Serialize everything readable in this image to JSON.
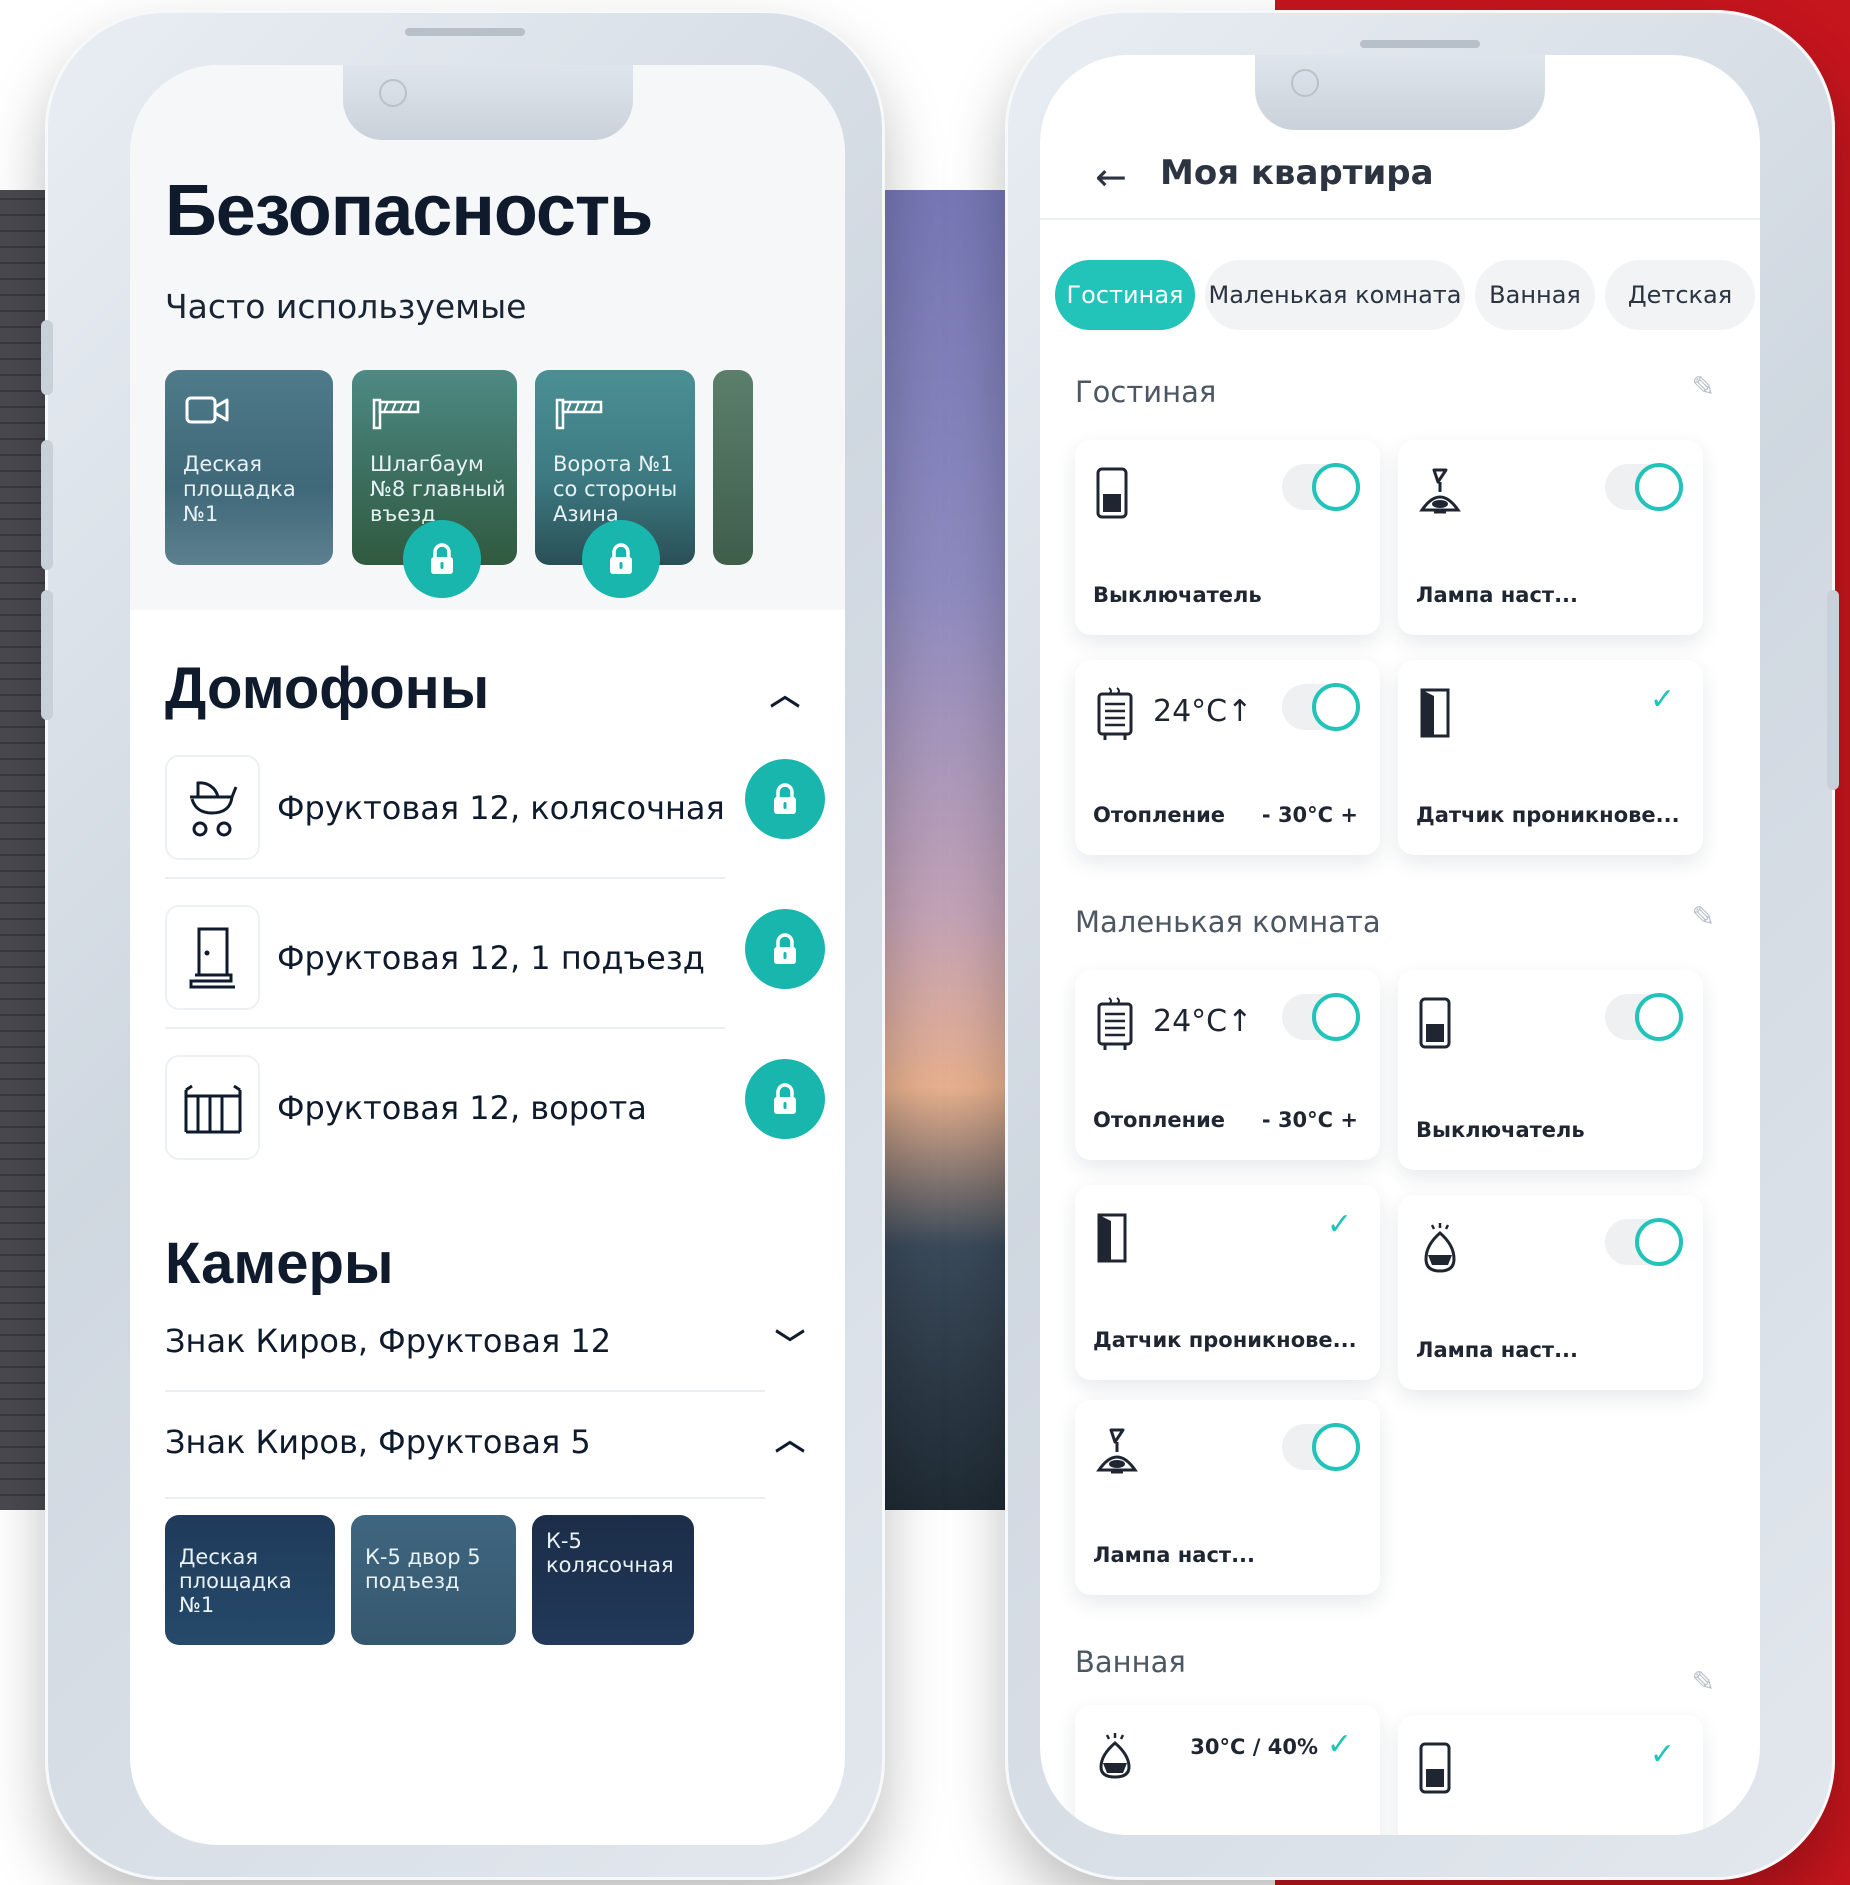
{
  "left_phone": {
    "title": "Безопасность",
    "favorites_heading": "Часто используемые",
    "favorites": [
      {
        "label": "Деская площадка №1",
        "icon": "video-camera-icon"
      },
      {
        "label": "Шлагбаум №8 главный въезд",
        "icon": "barrier-icon"
      },
      {
        "label": "Ворота №1 со стороны Азина",
        "icon": "barrier-icon"
      }
    ],
    "intercoms": {
      "heading": "Домофоны",
      "items": [
        {
          "label": "Фруктовая 12, колясочная",
          "icon": "stroller-icon"
        },
        {
          "label": "Фруктовая 12, 1 подъезд",
          "icon": "door-icon"
        },
        {
          "label": "Фруктовая 12, ворота",
          "icon": "gate-icon"
        }
      ]
    },
    "cameras": {
      "heading": "Камеры",
      "groups": [
        {
          "label": "Знак Киров, Фруктовая 12",
          "expanded": false
        },
        {
          "label": "Знак Киров, Фруктовая 5",
          "expanded": true
        }
      ],
      "thumbs": [
        "Деская площадка №1",
        "К-5 двор 5 подъезд",
        "К-5 колясочная"
      ]
    }
  },
  "right_phone": {
    "title": "Моя квартира",
    "tabs": [
      "Гостиная",
      "Маленькая комната",
      "Ванная",
      "Детская"
    ],
    "active_tab": "Гостиная",
    "rooms": [
      {
        "name": "Гостиная",
        "devices": [
          {
            "name": "Выключатель",
            "type": "switch",
            "state": "on"
          },
          {
            "name": "Лампа наст...",
            "type": "lamp",
            "state": "on"
          },
          {
            "name": "Отопление",
            "type": "heater",
            "temp": "24°C↑",
            "step": "- 30°C +",
            "state": "on"
          },
          {
            "name": "Датчик проникнове...",
            "type": "sensor",
            "state": "check"
          }
        ]
      },
      {
        "name": "Маленькая комната",
        "devices": [
          {
            "name": "Отопление",
            "type": "heater",
            "temp": "24°C↑",
            "step": "- 30°C +",
            "state": "on"
          },
          {
            "name": "Выключатель",
            "type": "switch",
            "state": "on"
          },
          {
            "name": "Датчик проникнове...",
            "type": "sensor",
            "state": "check"
          },
          {
            "name": "Лампа наст...",
            "type": "lamp2",
            "state": "on"
          },
          {
            "name": "Лампа наст...",
            "type": "lamp",
            "state": "on"
          }
        ]
      },
      {
        "name": "Ванная",
        "devices": [
          {
            "name": "",
            "type": "humidifier",
            "value": "30°C / 40%",
            "state": "check"
          },
          {
            "name": "",
            "type": "switch",
            "state": "check"
          }
        ]
      }
    ]
  },
  "colors": {
    "accent": "#22c3b9",
    "lock": "#19b6ad",
    "brand_red": "#c5151d",
    "text": "#0f1b2d"
  }
}
